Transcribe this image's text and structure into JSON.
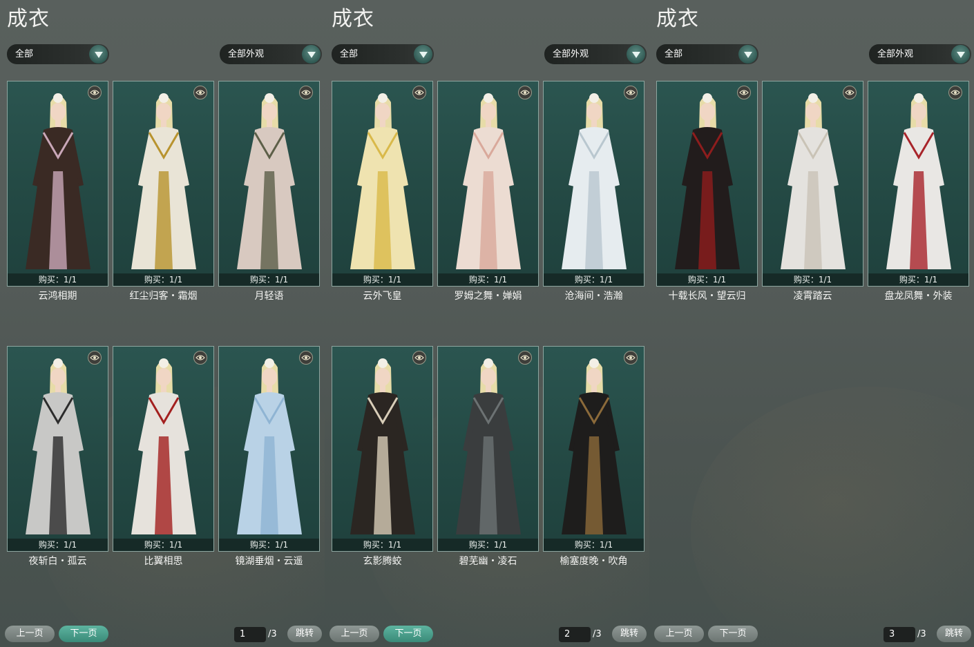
{
  "panels": [
    {
      "title": "成衣",
      "filter_left": "全部",
      "filter_right": "全部外观",
      "cards": [
        {
          "buy": "购买：1/1",
          "name": "云鸿相期",
          "color": "#3a2a24",
          "accent": "#c9a7b8"
        },
        {
          "buy": "购买：1/1",
          "name": "红尘归客・霜烟",
          "color": "#e9e4d6",
          "accent": "#b8932e"
        },
        {
          "buy": "购买：1/1",
          "name": "月轻语",
          "color": "#d8c9c0",
          "accent": "#5d5f48"
        },
        {
          "buy": "购买：1/1",
          "name": "夜斩白・孤云",
          "color": "#c8c8c6",
          "accent": "#2c2c2c"
        },
        {
          "buy": "购买：1/1",
          "name": "比翼相思",
          "color": "#e6e2dc",
          "accent": "#a3201f"
        },
        {
          "buy": "购买：1/1",
          "name": "镜湖垂烟・云遥",
          "color": "#b9d2e6",
          "accent": "#8fb4d3"
        }
      ],
      "prev": "上一页",
      "next": "下一页",
      "page": "1",
      "total": "/3",
      "jump": "跳转"
    },
    {
      "title": "成衣",
      "filter_left": "全部",
      "filter_right": "全部外观",
      "cards": [
        {
          "buy": "购买：1/1",
          "name": "云外飞皇",
          "color": "#efe3b0",
          "accent": "#d9b94a"
        },
        {
          "buy": "购买：1/1",
          "name": "罗姆之舞・婵娟",
          "color": "#ecdcd2",
          "accent": "#d9a99b"
        },
        {
          "buy": "购买：1/1",
          "name": "沧海间・浩瀚",
          "color": "#e6ecef",
          "accent": "#b9c7cf"
        },
        {
          "buy": "购买：1/1",
          "name": "玄影腾蛟",
          "color": "#2b2622",
          "accent": "#d8cdb8"
        },
        {
          "buy": "购买：1/1",
          "name": "碧芜幽・凌石",
          "color": "#3a3d3e",
          "accent": "#6c7273"
        },
        {
          "buy": "购买：1/1",
          "name": "榆塞度晚・吹角",
          "color": "#1e1d1c",
          "accent": "#8b6a3a"
        }
      ],
      "prev": "上一页",
      "next": "下一页",
      "page": "2",
      "total": "/3",
      "jump": "跳转"
    },
    {
      "title": "成衣",
      "filter_left": "全部",
      "filter_right": "全部外观",
      "cards": [
        {
          "buy": "购买：1/1",
          "name": "十载长风・望云归",
          "color": "#221c1c",
          "accent": "#8e1d1d"
        },
        {
          "buy": "购买：1/1",
          "name": "凌霄踏云",
          "color": "#e4e2de",
          "accent": "#c9c3b6"
        },
        {
          "buy": "购买：1/1",
          "name": "盘龙凤舞・外装",
          "color": "#e9e7e4",
          "accent": "#a8242a"
        }
      ],
      "prev": "上一页",
      "next": "下一页",
      "page": "3",
      "total": "/3",
      "jump": "跳转"
    }
  ]
}
